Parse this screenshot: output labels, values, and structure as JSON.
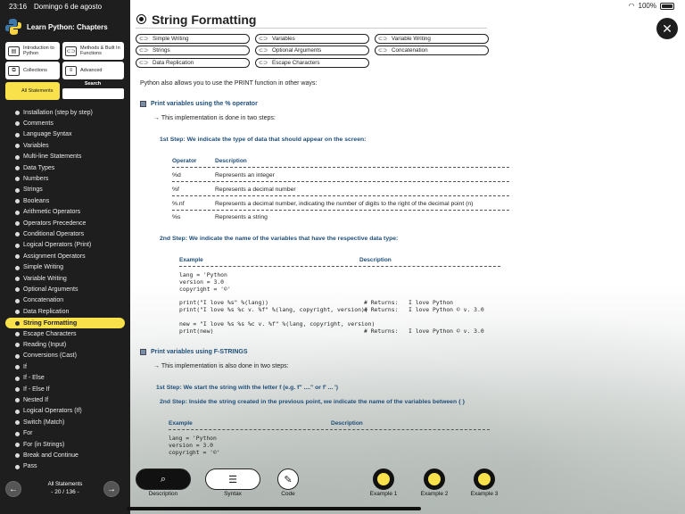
{
  "status": {
    "time": "23:16",
    "date": "Domingo 6 de agosto",
    "battery": "100%"
  },
  "app": {
    "title": "Learn Python: Chapters"
  },
  "chapters": [
    {
      "label": "Introduction to Python",
      "icon": "document-icon"
    },
    {
      "label": "Methods & Built In Functions",
      "icon": "link-icon"
    },
    {
      "label": "Collections",
      "icon": "collection-icon"
    },
    {
      "label": "Advanced",
      "icon": "list-icon"
    },
    {
      "label": "All Statements",
      "active": true
    }
  ],
  "search": {
    "label": "Search",
    "placeholder": ""
  },
  "topics": [
    "Installation (step by step)",
    "Comments",
    "Language Syntax",
    "Variables",
    "Multi-line Statements",
    "Data Types",
    "Numbers",
    "Strings",
    "Booleans",
    "Arithmetic Operators",
    "Operators Precedence",
    "Conditional Operators",
    "Logical Operators (Print)",
    "Assignment Operators",
    "Simple Writing",
    "Variable Writing",
    "Optional Arguments",
    "Concatenation",
    "Data Replication",
    "String Formatting",
    "Escape Characters",
    "Reading (Input)",
    "Conversions (Cast)",
    "If",
    "If - Else",
    "If - Else If",
    "Nested If",
    "Logical Operators (If)",
    "Switch (Match)",
    "For",
    "For (in Strings)",
    "Break and Continue",
    "Pass"
  ],
  "active_topic": "String Formatting",
  "footer": {
    "label": "All Statements",
    "count": "- 20 / 136 -"
  },
  "main": {
    "title": "String Formatting",
    "links": [
      "Simple Writing",
      "Variables",
      "Variable Writing",
      "Strings",
      "Optional Arguments",
      "Concatenation",
      "Data Replication",
      "Escape Characters"
    ],
    "intro": "Python also allows you to use the PRINT function in other ways:",
    "section1": {
      "heading": "Print variables using the % operator",
      "sub": "→ This implementation is done in two steps:",
      "step1": "1st Step: We indicate the type of data that should appear on the screen:",
      "table_headers": [
        "Operator",
        "Description"
      ],
      "rows": [
        [
          "%d",
          "Represents an integer"
        ],
        [
          "%f",
          "Represents a decimal number"
        ],
        [
          "%.nf",
          "Represents a decimal number, indicating the number of digits to the right of the decimal point (n)"
        ],
        [
          "%s",
          "Represents a string"
        ]
      ],
      "step2": "2nd Step: We indicate the name of the variables that have the respective data type:",
      "example_headers": [
        "Example",
        "Description"
      ],
      "code": {
        "block1": "lang = 'Python\nversion = 3.0\ncopyright = '©'",
        "print1": "print(\"I love %s\" %(lang))",
        "print2": "print(\"I love %s %c v. %f\" %(lang, copyright, version))",
        "ret1": "# Returns:   I love Python",
        "ret2": "# Returns:   I love Python © v. 3.0",
        "new1": "new = \"I love %s %s %c v. %f\" %(lang, copyright, version)",
        "new2": "print(new)",
        "ret3": "# Returns:   I love Python © v. 3.0"
      }
    },
    "section2": {
      "heading": "Print variables using F-STRINGS",
      "sub": "→ This implementation is also done in two steps:",
      "step1": "1st Step: We start the string with the letter f (e.g. f\" ....\" or f' ... ')",
      "step2": "2nd Step: Inside the string created in the previous point, we indicate the name of the variables between {  }",
      "example_headers": [
        "Example",
        "Description"
      ],
      "code": "lang = 'Python\nversion = 3.0\ncopyright = '©'"
    }
  },
  "bottom": {
    "tabs": [
      "Description",
      "Syntax",
      "Code"
    ],
    "examples": [
      "Example 1",
      "Example 2",
      "Example 3"
    ]
  }
}
